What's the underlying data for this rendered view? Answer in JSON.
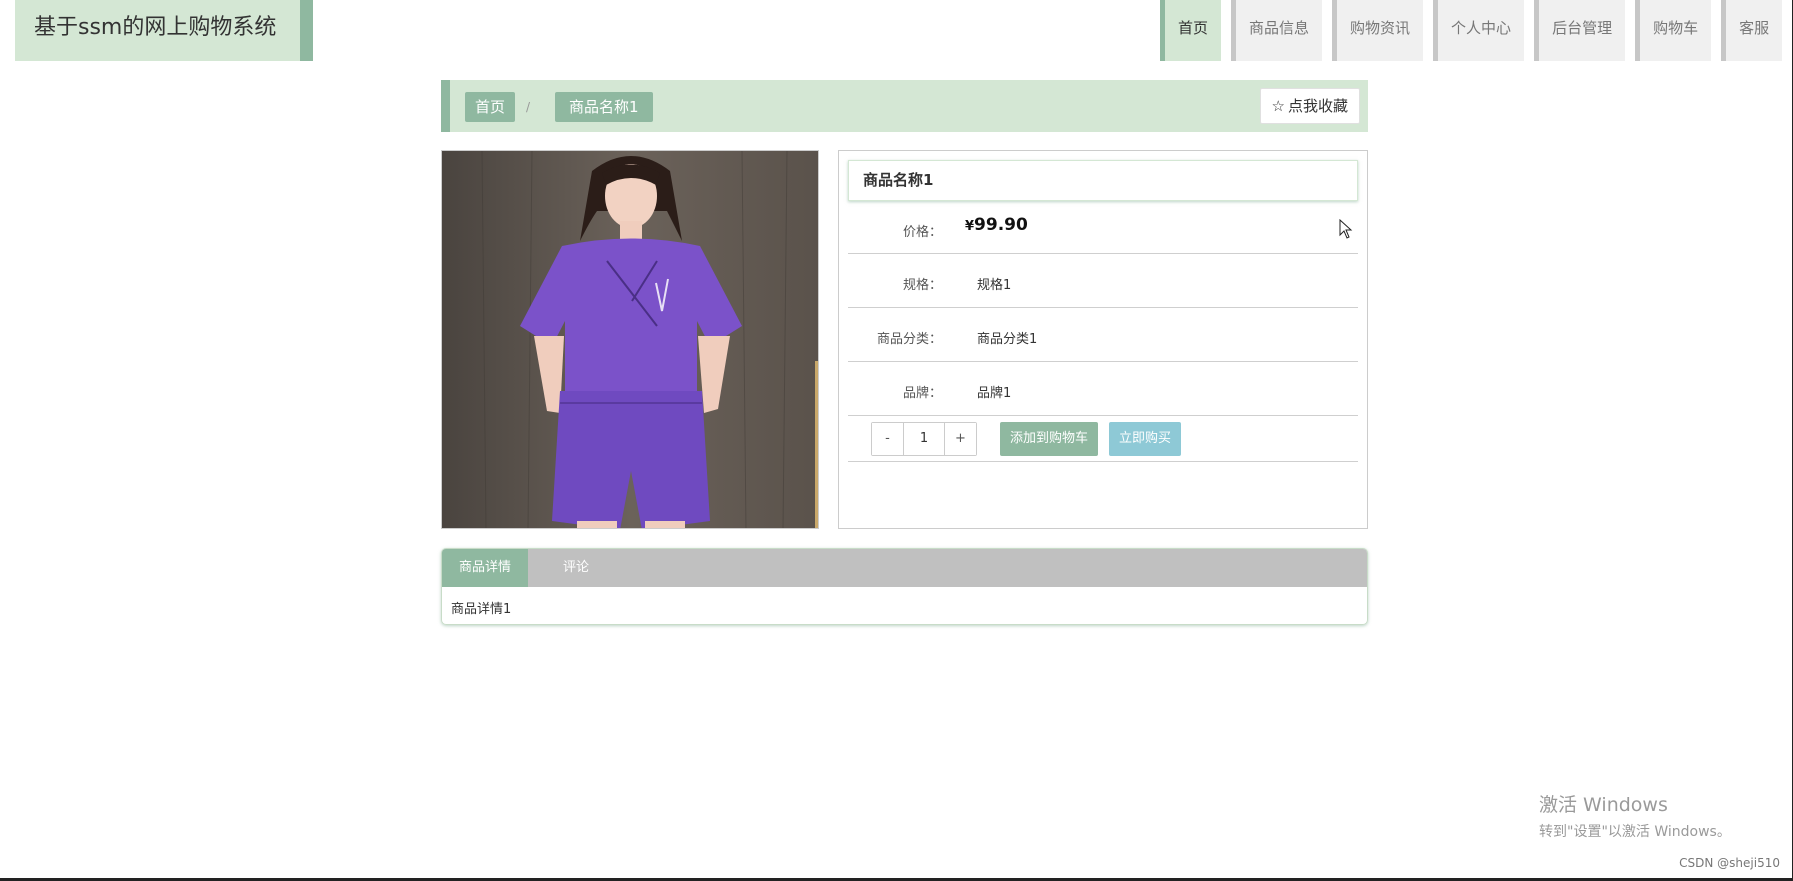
{
  "site_title": "基于ssm的网上购物系统",
  "nav": {
    "items": [
      "首页",
      "商品信息",
      "购物资讯",
      "个人中心",
      "后台管理",
      "购物车",
      "客服"
    ],
    "active_index": 0
  },
  "breadcrumb": {
    "home": "首页",
    "separator": "/",
    "current": "商品名称1"
  },
  "favorite_button": {
    "icon": "star-outline-icon",
    "glyph": "☆",
    "label": "点我收藏"
  },
  "product": {
    "title": "商品名称1",
    "price_label": "价格：",
    "price_currency": "¥",
    "price_value": "99.90",
    "spec_label": "规格：",
    "spec_value": "规格1",
    "category_label": "商品分类：",
    "category_value": "商品分类1",
    "brand_label": "品牌：",
    "brand_value": "品牌1"
  },
  "quantity": {
    "minus": "-",
    "value": "1",
    "plus": "+"
  },
  "actions": {
    "add_to_cart": "添加到购物车",
    "buy_now": "立即购买"
  },
  "tabs": {
    "detail": "商品详情",
    "comments": "评论",
    "content": "商品详情1"
  },
  "watermark": {
    "line1": "激活 Windows",
    "line2": "转到\"设置\"以激活 Windows。"
  },
  "credit": "CSDN @sheji510",
  "colors": {
    "primary": "#8fb8a0",
    "primary_light": "#d4e7d4",
    "buy_button": "#8ec9d6",
    "tab_bar": "#c0c0c0"
  }
}
